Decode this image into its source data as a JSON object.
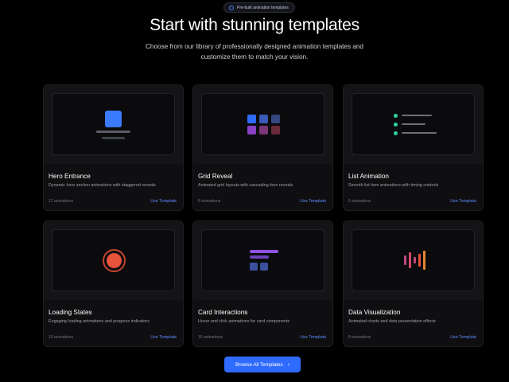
{
  "badge": {
    "label": "Pre-built animation templates"
  },
  "header": {
    "title": "Start with stunning templates",
    "subtitle": "Choose from our library of professionally designed animation templates and customize them to match your vision."
  },
  "cards": [
    {
      "title": "Hero Entrance",
      "description": "Dynamic hero section animations with staggered reveals",
      "count": "12 animations",
      "action": "Use Template"
    },
    {
      "title": "Grid Reveal",
      "description": "Animated grid layouts with cascading item reveals",
      "count": "8 animations",
      "action": "Use Template"
    },
    {
      "title": "List Animation",
      "description": "Smooth list item animations with timing controls",
      "count": "6 animations",
      "action": "Use Template"
    },
    {
      "title": "Loading States",
      "description": "Engaging loading animations and progress indicators",
      "count": "10 animations",
      "action": "Use Template"
    },
    {
      "title": "Card Interactions",
      "description": "Hover and click animations for card components",
      "count": "15 animations",
      "action": "Use Template"
    },
    {
      "title": "Data Visualization",
      "description": "Animated charts and data presentation effects",
      "count": "8 animations",
      "action": "Use Template"
    }
  ],
  "cta": {
    "label": "Browse All Templates",
    "icon": "chevron-right-icon"
  },
  "colors": {
    "accent": "#2f6bff",
    "link": "#5d8cff",
    "teal": "#2bd3a8",
    "red": "#e5533c"
  }
}
